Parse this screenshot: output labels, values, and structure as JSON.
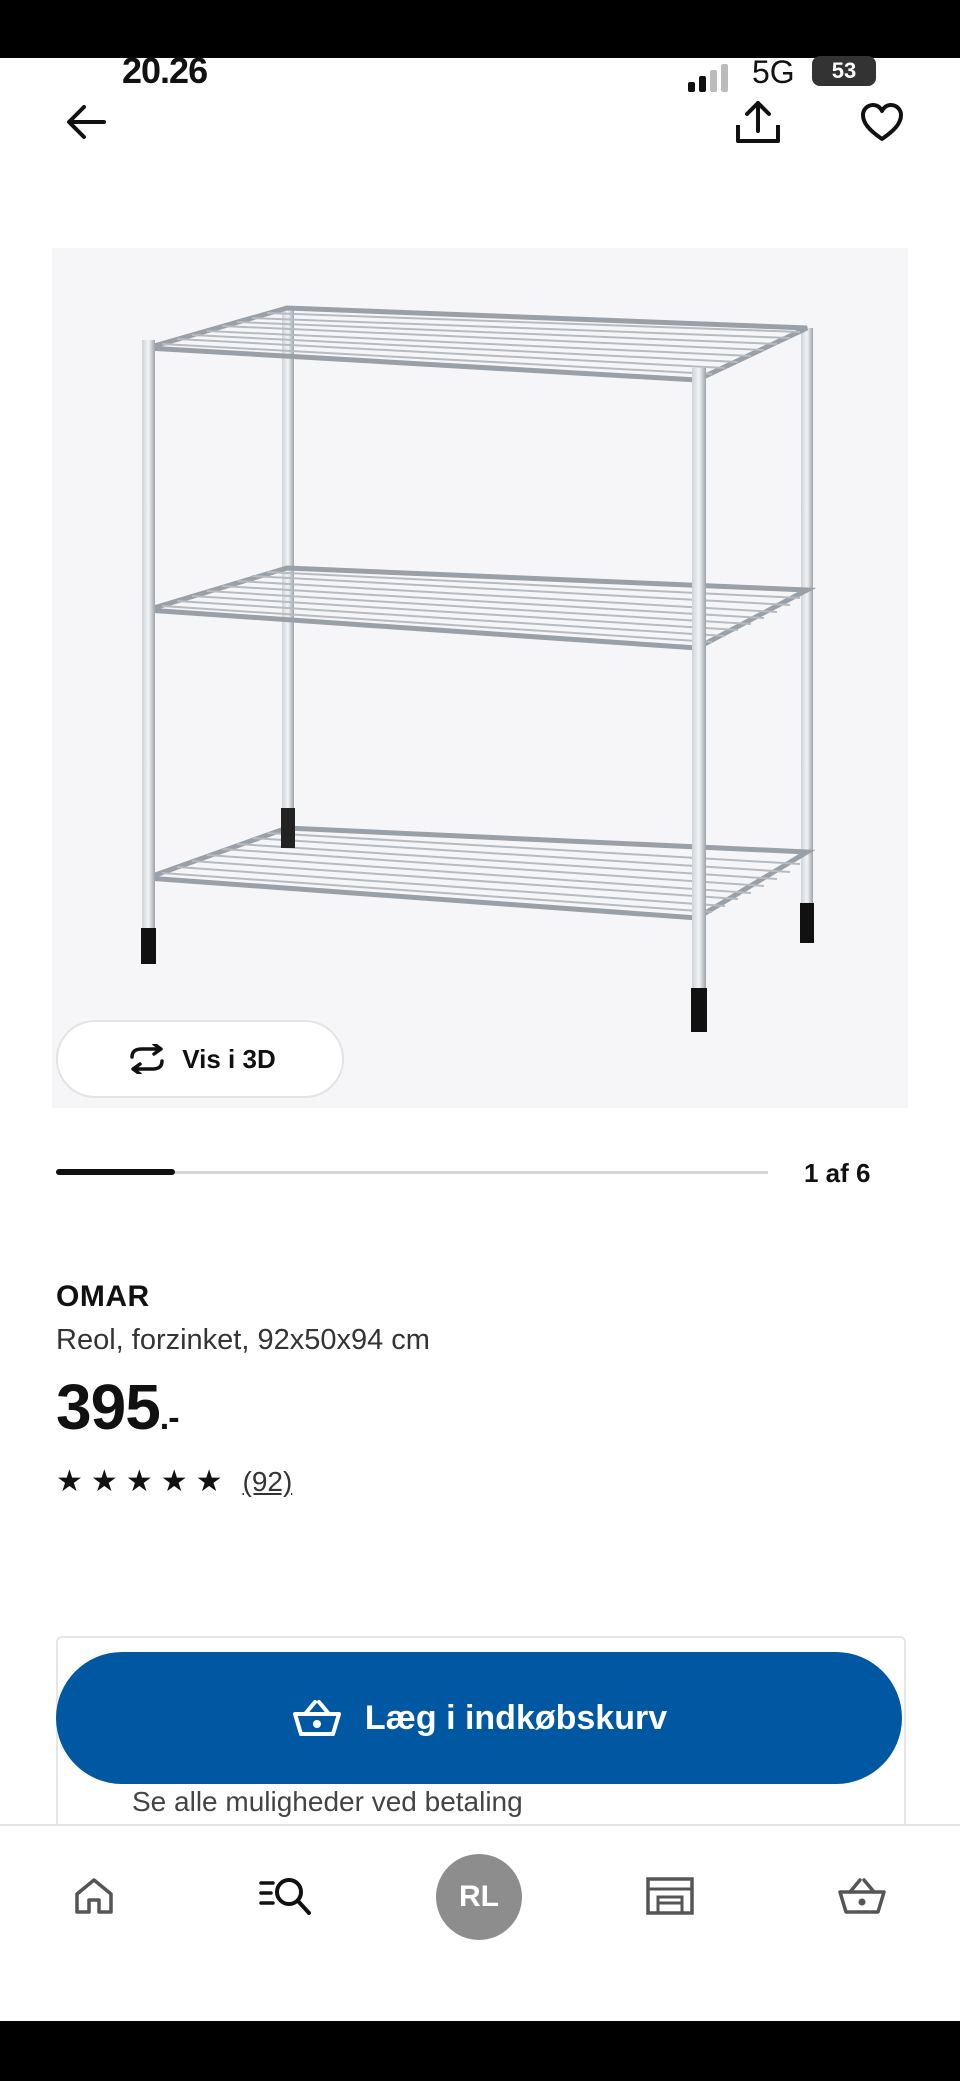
{
  "status_bar": {
    "time": "20.26",
    "network": "5G",
    "battery": "53"
  },
  "header": {
    "back_icon": "arrow-left-icon",
    "share_icon": "share-icon",
    "favorite_icon": "heart-icon"
  },
  "gallery": {
    "view_3d_label": "Vis i 3D",
    "pager_text": "1 af 6",
    "progress": 0.1667
  },
  "product": {
    "name": "OMAR",
    "description": "Reol, forzinket, 92x50x94 cm",
    "price_main": "395",
    "price_suffix": ".-",
    "rating_stars": 5,
    "review_count": "(92)"
  },
  "purchase": {
    "add_to_cart_label": "Læg i indkøbskurv",
    "payment_note": "Se alle muligheder ved betaling"
  },
  "bottom_nav": {
    "avatar_initials": "RL",
    "items": [
      "home-icon",
      "search-icon",
      "profile-avatar",
      "store-icon",
      "cart-icon"
    ]
  },
  "colors": {
    "accent": "#0058a3",
    "background": "#ffffff",
    "text": "#111111"
  }
}
